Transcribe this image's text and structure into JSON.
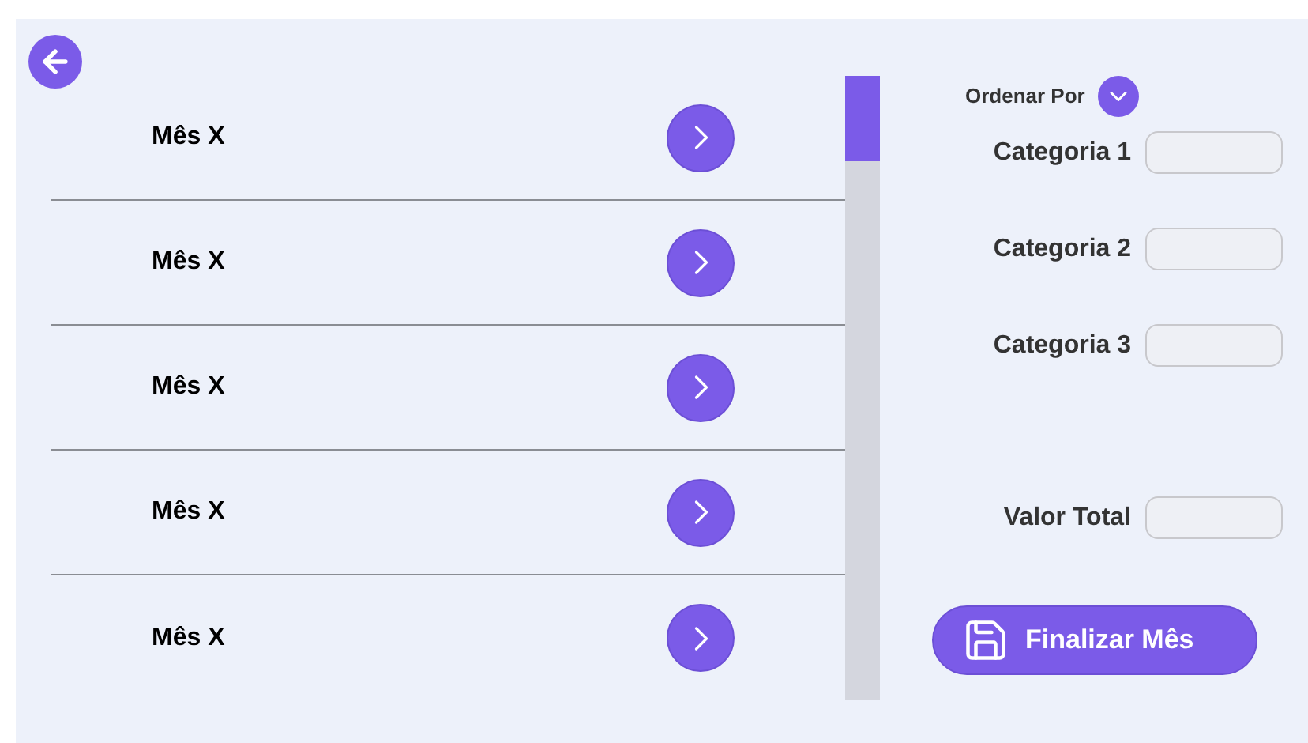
{
  "months": [
    {
      "label": "Mês X"
    },
    {
      "label": "Mês X"
    },
    {
      "label": "Mês X"
    },
    {
      "label": "Mês X"
    },
    {
      "label": "Mês X"
    }
  ],
  "sort": {
    "label": "Ordenar Por"
  },
  "categories": [
    {
      "label": "Categoria 1"
    },
    {
      "label": "Categoria 2"
    },
    {
      "label": "Categoria 3"
    }
  ],
  "total": {
    "label": "Valor Total"
  },
  "finish_button": {
    "label": "Finalizar Mês"
  }
}
